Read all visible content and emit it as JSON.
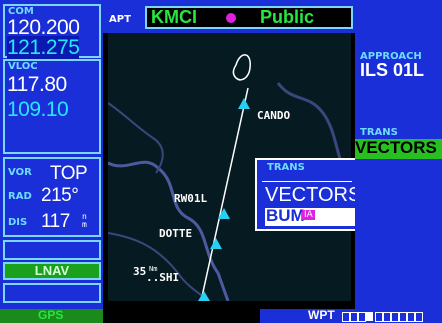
{
  "left": {
    "com_label": "COM",
    "com_active": "120.200",
    "com_standby": "121.275",
    "vloc_label": "VLOC",
    "vloc_active": "117.80",
    "vloc_standby": "109.10",
    "vor_label": "VOR",
    "vor_id": "TOP",
    "rad_label": "RAD",
    "rad_value": "215°",
    "dis_label": "DIS",
    "dis_value": "117",
    "dis_unit": "n m",
    "cdi_mode": "LNAV"
  },
  "top": {
    "apt_label": "APT",
    "apt_id": "KMCI",
    "apt_type": "Public"
  },
  "right": {
    "approach_label": "APPROACH",
    "approach_value": "ILS 01L",
    "trans_label": "TRANS",
    "trans_value": "VECTORS"
  },
  "popup": {
    "title": "TRANS",
    "option_1": "VECTORS",
    "option_2": "BUM",
    "option_2_suffix": "IA"
  },
  "map": {
    "waypoints": [
      "CANDO",
      "RW01L",
      "DOTTE",
      "..SHI"
    ],
    "altitude": "35",
    "altitude_unit": "Nm"
  },
  "bottom": {
    "gps_label": "GPS",
    "page_label": "WPT"
  },
  "colors": {
    "panel_blue": "#1a2fd8",
    "label_cyan": "#6fdcff",
    "active_green": "#27e640",
    "popup_magenta": "#e020e0"
  }
}
